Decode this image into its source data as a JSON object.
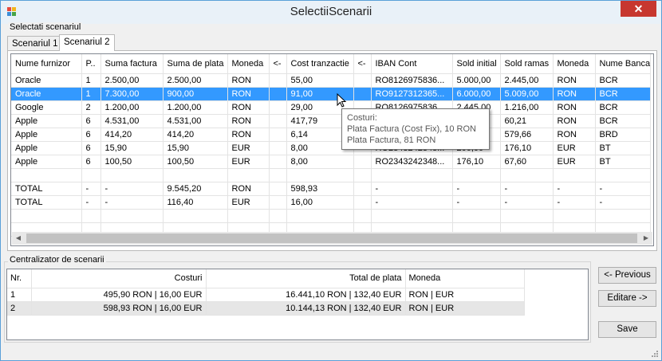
{
  "window": {
    "title": "SelectiiScenarii",
    "close_glyph": "✕"
  },
  "group_selectati": {
    "title": "Selectati scenariul"
  },
  "tabs": [
    {
      "label": "Scenariul 1"
    },
    {
      "label": "Scenariul 2"
    }
  ],
  "scenario_grid": {
    "headers": [
      "Nume furnizor",
      "P..",
      "Suma factura",
      "Suma de plata",
      "Moneda",
      "<-",
      "Cost tranzactie",
      "<-",
      "IBAN Cont",
      "Sold initial",
      "Sold ramas",
      "Moneda",
      "Nume Banca"
    ],
    "rows": [
      [
        "Oracle",
        "1",
        "2.500,00",
        "2.500,00",
        "RON",
        "",
        "55,00",
        "",
        "RO8126975836...",
        "5.000,00",
        "2.445,00",
        "RON",
        "BCR"
      ],
      [
        "Oracle",
        "1",
        "7.300,00",
        "900,00",
        "RON",
        "",
        "91,00",
        "",
        "RO9127312365...",
        "6.000,00",
        "5.009,00",
        "RON",
        "BCR"
      ],
      [
        "Google",
        "2",
        "1.200,00",
        "1.200,00",
        "RON",
        "",
        "29,00",
        "",
        "RO8126975836...",
        "2.445,00",
        "1.216,00",
        "RON",
        "BCR"
      ],
      [
        "Apple",
        "6",
        "4.531,00",
        "4.531,00",
        "RON",
        "",
        "417,79",
        "",
        "",
        "",
        "60,21",
        "RON",
        "BCR"
      ],
      [
        "Apple",
        "6",
        "414,20",
        "414,20",
        "RON",
        "",
        "6,14",
        "",
        "",
        "",
        "579,66",
        "RON",
        "BRD"
      ],
      [
        "Apple",
        "6",
        "15,90",
        "15,90",
        "EUR",
        "",
        "8,00",
        "",
        "RO2343242348...",
        "200,00",
        "176,10",
        "EUR",
        "BT"
      ],
      [
        "Apple",
        "6",
        "100,50",
        "100,50",
        "EUR",
        "",
        "8,00",
        "",
        "RO2343242348...",
        "176,10",
        "67,60",
        "EUR",
        "BT"
      ],
      [
        "",
        "",
        "",
        "",
        "",
        "",
        "",
        "",
        "",
        "",
        "",
        "",
        ""
      ],
      [
        "TOTAL",
        "-",
        "-",
        "9.545,20",
        "RON",
        "",
        "598,93",
        "",
        "-",
        "-",
        "-",
        "-",
        "-"
      ],
      [
        "TOTAL",
        "-",
        "-",
        "116,40",
        "EUR",
        "",
        "16,00",
        "",
        "-",
        "-",
        "-",
        "-",
        "-"
      ]
    ],
    "selected_row": 1
  },
  "tooltip": {
    "line1": "Costuri:",
    "line2": "Plata Factura (Cost Fix), 10 RON",
    "line3": "Plata Factura, 81 RON"
  },
  "group_centralizator": {
    "title": "Centralizator de scenarii"
  },
  "summary_grid": {
    "headers": [
      "Nr.",
      "Costuri",
      "Total de plata",
      "Moneda"
    ],
    "rows": [
      [
        "1",
        "495,90 RON  | 16,00 EUR",
        "16.441,10 RON  | 132,40 EUR",
        "RON | EUR"
      ],
      [
        "2",
        "598,93 RON  | 16,00 EUR",
        "10.144,13 RON  | 132,40 EUR",
        "RON | EUR"
      ]
    ]
  },
  "buttons": {
    "previous": "<- Previous",
    "editare": "Editare ->",
    "save": "Save"
  },
  "scroll_arrows": {
    "left": "◀",
    "right": "▶"
  }
}
